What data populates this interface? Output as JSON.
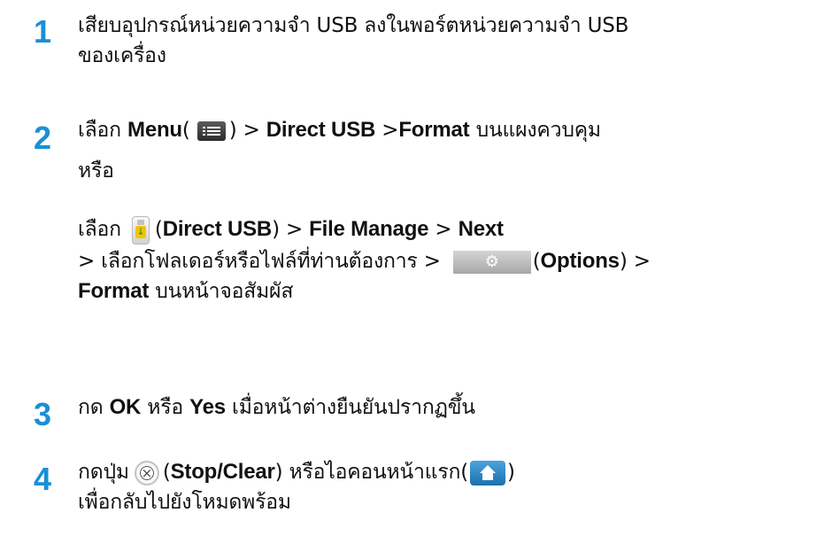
{
  "steps": [
    {
      "number": "1",
      "text_a": "เสียบอุปกรณ์หน่วยความจำ USB ลงในพอร์ตหน่วยความจำ USB",
      "text_b": "ของเครื่อง"
    },
    {
      "number": "2",
      "choose": "เลือก",
      "menu": "Menu",
      "paren_open": "(",
      "paren_close": ")",
      "sep": " > ",
      "direct_usb": "Direct USB",
      "sep_tight": " >",
      "format": "Format",
      "on_panel": " บนแผงควบคุม",
      "or": "หรือ",
      "choose2": "เลือก",
      "usb_paren_open": "(",
      "direct_usb2": "Direct USB",
      "usb_paren_close": ")",
      "sep2": " > ",
      "file_manage": "File Manage",
      "sep3": " > ",
      "next": "Next",
      "select_text": "> เลือกโฟลเดอร์หรือไฟล์ที่ท่านต้องการ >",
      "opt_paren_open": "(",
      "options": "Options",
      "opt_paren_close_sep": ") >",
      "format2": "Format",
      "on_touch": " บนหน้าจอสัมผัส"
    },
    {
      "number": "3",
      "press": "กด ",
      "ok": "OK",
      "or": " หรือ ",
      "yes": "Yes",
      "rest": " เมื่อหน้าต่างยืนยันปรากฏขึ้น"
    },
    {
      "number": "4",
      "press_btn": "กดปุ่ม",
      "paren_open": "(",
      "stop_clear": "Stop/Clear",
      "after_stop": ") หรือไอคอนหน้าแรก(",
      "paren_close": ")",
      "line2": "เพื่อกลับไปยังโหมดพร้อม"
    }
  ],
  "icons": {
    "menu": "menu-icon",
    "usb": "usb-drive-icon",
    "options": "gear-icon",
    "stop": "stop-clear-icon",
    "home": "home-icon",
    "accent": "#1a8fd6"
  }
}
